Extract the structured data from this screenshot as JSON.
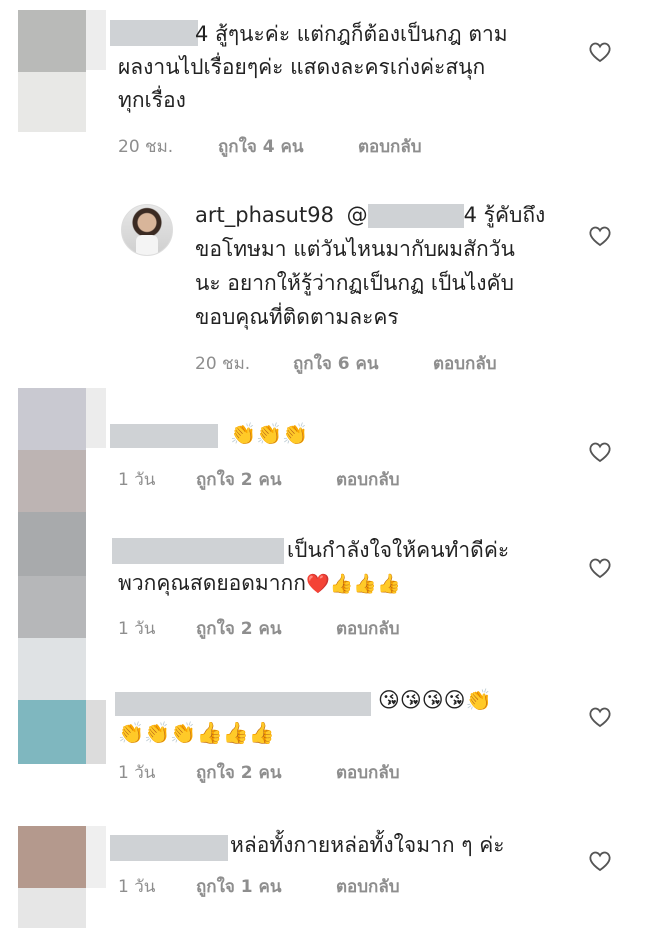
{
  "comments": [
    {
      "lines": [
        "4 สู้ๆนะค่ะ  แต่กฎก็ต้องเป็นกฎ  ตาม",
        "ผลงานไปเรื่อยๆค่ะ แสดงละครเก่งค่ะสนุก",
        "ทุกเรื่อง"
      ],
      "time": "20 ชม.",
      "likes": "ถูกใจ 4 คน",
      "reply": "ตอบกลับ"
    },
    {
      "username": "art_phasut98",
      "mention_prefix": "@",
      "mention_suffix": "4 รู้คับถึง",
      "lines": [
        "ขอโทษมา แต่วันไหนมากับผมสักวัน",
        "นะ อยากให้รู้ว่ากฏเป็นกฏ เป็นไงคับ",
        "ขอบคุณที่ติดตามละคร"
      ],
      "time": "20 ชม.",
      "likes": "ถูกใจ 6 คน",
      "reply": "ตอบกลับ"
    },
    {
      "emojis": "👏👏👏",
      "time": "1 วัน",
      "likes": "ถูกใจ 2 คน",
      "reply": "ตอบกลับ"
    },
    {
      "lines": [
        "เป็นกำลังใจให้คนทำดีค่ะ",
        "พวกคุณสดยอดมากก"
      ],
      "emojis": "❤️👍👍👍",
      "time": "1 วัน",
      "likes": "ถูกใจ 2 คน",
      "reply": "ตอบกลับ"
    },
    {
      "emojis_line1": "😘😘😘😘👏",
      "emojis_line2": "👏👏👏👍👍👍",
      "time": "1 วัน",
      "likes": "ถูกใจ 2 คน",
      "reply": "ตอบกลับ"
    },
    {
      "lines": [
        "หล่อทั้งกายหล่อทั้งใจมาก ๆ ค่ะ"
      ],
      "time": "1 วัน",
      "likes": "ถูกใจ 1 คน",
      "reply": "ตอบกลับ"
    }
  ],
  "icons": {
    "like": "heart-outline-icon"
  },
  "colors": {
    "meta": "#8e8e8e",
    "text": "#262626"
  }
}
